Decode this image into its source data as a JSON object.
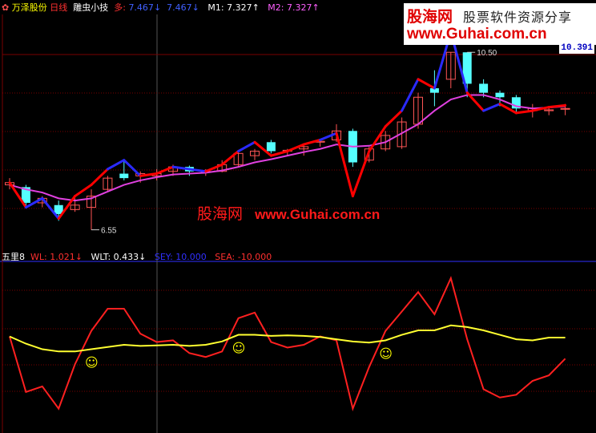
{
  "header": {
    "stock_name": "万泽股份",
    "period": "日线",
    "indicator": "雕虫小技",
    "duo_label": "多:",
    "duo_value": "7.467",
    "second_value": "7.467",
    "m1_label": "M1:",
    "m1_value": "7.327",
    "m2_label": "M2:",
    "m2_value": "7.327",
    "down_arrow": "↓",
    "up_arrow": "↑"
  },
  "sub_header": {
    "name": "五里8",
    "wl_label": "WL:",
    "wl_value": "1.021",
    "wlt_label": "WLT:",
    "wlt_value": "0.433",
    "sey_label": "SEY:",
    "sey_value": "10.000",
    "sea_label": "SEA:",
    "sea_value": "-10.000"
  },
  "watermark": {
    "brand": "股海网",
    "slogan": "股票软件资源分享",
    "url": "www.Guhai.com.cn"
  },
  "center_watermark": {
    "brand": "股海网",
    "url": "www.Guhai.com.cn"
  },
  "price_tag": "10.391",
  "colors": {
    "up_candle": "#ff5555",
    "down_candle": "#55ffff",
    "duo_red": "#ff0000",
    "duo_blue": "#2a2aff",
    "ma_line": "#e040e0",
    "wl_line": "#ff2020",
    "wlt_line": "#ffff30",
    "grid_red": "#7a0000",
    "axis_blue": "#3030ff",
    "smiley": "#ffff00"
  },
  "chart_data": [
    {
      "type": "candlestick",
      "annotations": [
        {
          "text": "6.55",
          "index": 5
        },
        {
          "text": "10.50",
          "index": 28
        }
      ],
      "candles": [
        {
          "o": 7.55,
          "h": 7.7,
          "l": 7.45,
          "c": 7.6,
          "dir": "up"
        },
        {
          "o": 7.5,
          "h": 7.55,
          "l": 7.05,
          "c": 7.15,
          "dir": "down"
        },
        {
          "o": 7.15,
          "h": 7.3,
          "l": 7.05,
          "c": 7.25,
          "dir": "up"
        },
        {
          "o": 7.1,
          "h": 7.2,
          "l": 6.75,
          "c": 6.9,
          "dir": "down"
        },
        {
          "o": 7.1,
          "h": 7.25,
          "l": 6.95,
          "c": 7.0,
          "dir": "up"
        },
        {
          "o": 7.05,
          "h": 7.45,
          "l": 6.55,
          "c": 7.3,
          "dir": "up"
        },
        {
          "o": 7.45,
          "h": 7.75,
          "l": 7.4,
          "c": 7.7,
          "dir": "up"
        },
        {
          "o": 7.8,
          "h": 8.1,
          "l": 7.65,
          "c": 7.7,
          "dir": "down"
        },
        {
          "o": 7.8,
          "h": 7.85,
          "l": 7.6,
          "c": 7.75,
          "dir": "up"
        },
        {
          "o": 7.75,
          "h": 7.9,
          "l": 7.65,
          "c": 7.8,
          "dir": "up"
        },
        {
          "o": 7.85,
          "h": 8.0,
          "l": 7.75,
          "c": 7.95,
          "dir": "up"
        },
        {
          "o": 7.95,
          "h": 7.98,
          "l": 7.75,
          "c": 7.85,
          "dir": "down"
        },
        {
          "o": 7.85,
          "h": 7.9,
          "l": 7.75,
          "c": 7.83,
          "dir": "up"
        },
        {
          "o": 7.85,
          "h": 8.1,
          "l": 7.83,
          "c": 8.0,
          "dir": "up"
        },
        {
          "o": 8.0,
          "h": 8.3,
          "l": 7.95,
          "c": 8.25,
          "dir": "up"
        },
        {
          "o": 8.2,
          "h": 8.35,
          "l": 8.1,
          "c": 8.3,
          "dir": "up"
        },
        {
          "o": 8.5,
          "h": 8.55,
          "l": 8.25,
          "c": 8.3,
          "dir": "down"
        },
        {
          "o": 8.3,
          "h": 8.35,
          "l": 8.2,
          "c": 8.32,
          "dir": "up"
        },
        {
          "o": 8.35,
          "h": 8.45,
          "l": 8.2,
          "c": 8.4,
          "dir": "up"
        },
        {
          "o": 8.5,
          "h": 8.55,
          "l": 8.4,
          "c": 8.52,
          "dir": "up"
        },
        {
          "o": 8.55,
          "h": 8.9,
          "l": 8.5,
          "c": 8.75,
          "dir": "up"
        },
        {
          "o": 8.75,
          "h": 8.8,
          "l": 7.95,
          "c": 8.05,
          "dir": "down"
        },
        {
          "o": 8.1,
          "h": 8.4,
          "l": 8.05,
          "c": 8.35,
          "dir": "up"
        },
        {
          "o": 8.35,
          "h": 8.75,
          "l": 8.3,
          "c": 8.65,
          "dir": "up"
        },
        {
          "o": 8.4,
          "h": 9.05,
          "l": 8.35,
          "c": 8.95,
          "dir": "up"
        },
        {
          "o": 8.9,
          "h": 9.6,
          "l": 8.8,
          "c": 9.5,
          "dir": "up"
        },
        {
          "o": 9.7,
          "h": 10.1,
          "l": 9.3,
          "c": 9.6,
          "dir": "down"
        },
        {
          "o": 9.9,
          "h": 10.5,
          "l": 9.7,
          "c": 10.5,
          "dir": "up"
        },
        {
          "o": 10.5,
          "h": 10.5,
          "l": 9.5,
          "c": 9.8,
          "dir": "down"
        },
        {
          "o": 9.8,
          "h": 9.9,
          "l": 9.5,
          "c": 9.6,
          "dir": "down"
        },
        {
          "o": 9.6,
          "h": 9.65,
          "l": 9.3,
          "c": 9.5,
          "dir": "down"
        },
        {
          "o": 9.5,
          "h": 9.55,
          "l": 9.15,
          "c": 9.25,
          "dir": "down"
        },
        {
          "o": 9.2,
          "h": 9.35,
          "l": 9.05,
          "c": 9.25,
          "dir": "up"
        },
        {
          "o": 9.2,
          "h": 9.3,
          "l": 9.1,
          "c": 9.22,
          "dir": "up"
        },
        {
          "o": 9.25,
          "h": 9.35,
          "l": 9.1,
          "c": 9.25,
          "dir": "up"
        }
      ],
      "duo_line": [
        7.6,
        7.05,
        7.25,
        6.8,
        7.3,
        7.55,
        7.9,
        8.1,
        7.75,
        7.8,
        7.95,
        7.9,
        7.85,
        8.0,
        8.3,
        8.5,
        8.2,
        8.3,
        8.45,
        8.55,
        8.7,
        7.3,
        8.3,
        8.85,
        9.2,
        9.9,
        9.7,
        10.95,
        9.6,
        9.2,
        9.35,
        9.15,
        9.2,
        9.28,
        9.32
      ],
      "duo_colors": [
        "blue",
        "red",
        "blue",
        "blue",
        "red",
        "red",
        "red",
        "blue",
        "blue",
        "red",
        "red",
        "blue",
        "blue",
        "red",
        "red",
        "blue",
        "red",
        "red",
        "red",
        "red",
        "blue",
        "red",
        "red",
        "red",
        "red",
        "blue",
        "red",
        "blue",
        "blue",
        "red",
        "blue",
        "red",
        "red",
        "red",
        "red"
      ],
      "ma_line": [
        7.55,
        7.45,
        7.38,
        7.25,
        7.2,
        7.25,
        7.4,
        7.55,
        7.65,
        7.72,
        7.78,
        7.8,
        7.82,
        7.87,
        7.95,
        8.05,
        8.12,
        8.2,
        8.28,
        8.35,
        8.45,
        8.4,
        8.42,
        8.5,
        8.7,
        8.9,
        9.2,
        9.45,
        9.55,
        9.55,
        9.45,
        9.3,
        9.25,
        9.27,
        9.3
      ]
    },
    {
      "type": "line",
      "series": [
        {
          "name": "WL",
          "values": [
            0.45,
            -0.55,
            -0.45,
            -0.85,
            -0.05,
            0.55,
            0.95,
            0.95,
            0.5,
            0.35,
            0.38,
            0.15,
            0.08,
            0.18,
            0.78,
            0.88,
            0.35,
            0.25,
            0.3,
            0.45,
            0.38,
            -0.85,
            -0.1,
            0.55,
            0.9,
            1.25,
            0.85,
            1.5,
            0.4,
            -0.5,
            -0.65,
            -0.6,
            -0.35,
            -0.25,
            0.05
          ]
        },
        {
          "name": "WLT",
          "values": [
            0.45,
            0.32,
            0.22,
            0.18,
            0.18,
            0.22,
            0.26,
            0.3,
            0.28,
            0.29,
            0.3,
            0.28,
            0.3,
            0.36,
            0.48,
            0.48,
            0.46,
            0.47,
            0.46,
            0.44,
            0.4,
            0.36,
            0.34,
            0.38,
            0.48,
            0.56,
            0.56,
            0.65,
            0.62,
            0.56,
            0.48,
            0.4,
            0.38,
            0.43,
            0.43
          ]
        }
      ],
      "markers": [
        {
          "symbol": "☺",
          "index": 5
        },
        {
          "symbol": "☺",
          "index": 14
        },
        {
          "symbol": "☺",
          "index": 23
        }
      ]
    }
  ]
}
